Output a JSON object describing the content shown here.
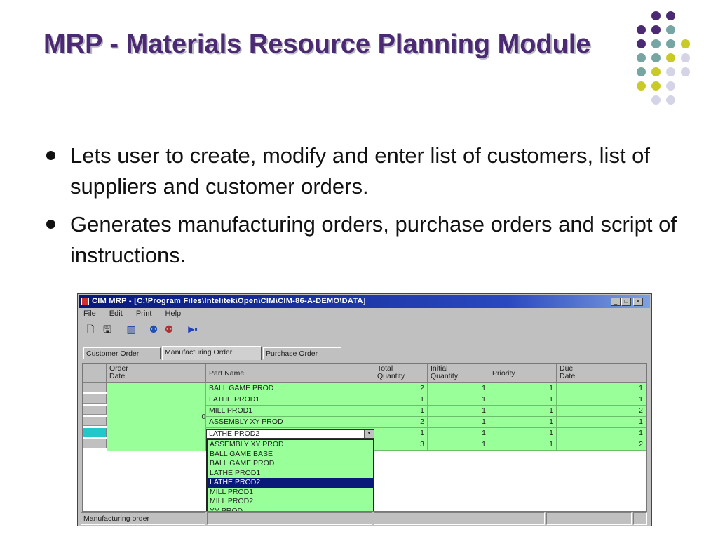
{
  "slide": {
    "title": "MRP - Materials Resource Planning Module",
    "bullets": [
      "Lets user to create, modify and enter list of customers, list of suppliers and customer orders.",
      "Generates manufacturing orders, purchase orders and script of instructions."
    ],
    "colors": {
      "title": "#4b2a73",
      "dot_purple": "#4b2a73",
      "dot_teal": "#76a5a4",
      "dot_yellow": "#c9c928",
      "dot_lavender": "#d4d4e6"
    }
  },
  "app_window": {
    "title": "CIM MRP - [C:\\Program Files\\Intelitek\\Open\\CIM\\CIM-86-A-DEMO\\DATA]",
    "menu": [
      "File",
      "Edit",
      "Print",
      "Help"
    ],
    "toolbar_icons": [
      "new-document-icon",
      "save-disk-icon",
      "chart-icon",
      "people-icon",
      "people-alt-icon",
      "mrp-run-icon"
    ],
    "tabs": [
      "Customer Order",
      "Manufacturing Order",
      "Purchase Order"
    ],
    "active_tab": 1,
    "grid": {
      "columns": [
        "Order\nDate",
        "Part Name",
        "Total\nQuantity",
        "Initial\nQuantity",
        "Priority",
        "Due\nDate"
      ],
      "date_fragment": "0",
      "rows": [
        {
          "part": "BALL GAME PROD",
          "total": "2",
          "initial": "1",
          "priority": "1",
          "due": "1"
        },
        {
          "part": "LATHE PROD1",
          "total": "1",
          "initial": "1",
          "priority": "1",
          "due": "1"
        },
        {
          "part": "MILL PROD1",
          "total": "1",
          "initial": "1",
          "priority": "1",
          "due": "2"
        },
        {
          "part": "ASSEMBLY XY PROD",
          "total": "2",
          "initial": "1",
          "priority": "1",
          "due": "1"
        },
        {
          "part": "LATHE PROD2",
          "total": "1",
          "initial": "1",
          "priority": "1",
          "due": "1"
        },
        {
          "part": "",
          "total": "3",
          "initial": "1",
          "priority": "1",
          "due": "2"
        }
      ],
      "current_row": 4,
      "combo_value": "LATHE PROD2",
      "dropdown_options": [
        "ASSEMBLY XY PROD",
        "BALL GAME BASE",
        "BALL GAME PROD",
        "LATHE PROD1",
        "LATHE PROD2",
        "MILL PROD1",
        "MILL PROD2",
        "XY PROD"
      ],
      "dropdown_selected": 4
    },
    "status_text": "Manufacturing order"
  }
}
